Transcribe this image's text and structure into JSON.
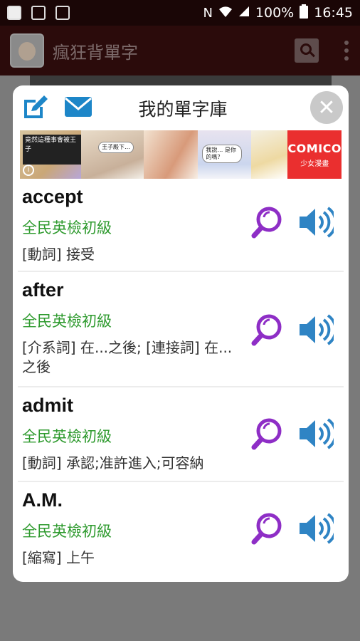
{
  "status_bar": {
    "battery": "100%",
    "time": "16:45",
    "network_glyph": "N"
  },
  "app_bar": {
    "title": "瘋狂背單字",
    "icons": [
      "app-logo",
      "search-icon",
      "overflow-menu-icon"
    ]
  },
  "dialog": {
    "title": "我的單字庫",
    "icons": [
      "edit-icon",
      "mail-icon",
      "close-icon"
    ],
    "close_glyph": "✕"
  },
  "banner": {
    "caption_1": "竟然這種事會被王子",
    "caption_2": "王子殿下…",
    "caption_3": "我說… 是你的嗎？",
    "brand": "COMICO",
    "subtitle": "少女漫畫"
  },
  "words": [
    {
      "word": "accept",
      "level": "全民英檢初級",
      "definition": "[動詞] 接受"
    },
    {
      "word": "after",
      "level": "全民英檢初級",
      "definition": "[介系詞] 在...之後; [連接詞] 在...之後"
    },
    {
      "word": "admit",
      "level": "全民英檢初級",
      "definition": "[動詞] 承認;准許進入;可容納"
    },
    {
      "word": "A.M.",
      "level": "全民英檢初級",
      "definition": "[縮寫] 上午"
    }
  ],
  "colors": {
    "accent_blue": "#1d86c8",
    "purple": "#8e2ec6",
    "level_green": "#2e9a2e",
    "sound_blue": "#2f84c4"
  }
}
